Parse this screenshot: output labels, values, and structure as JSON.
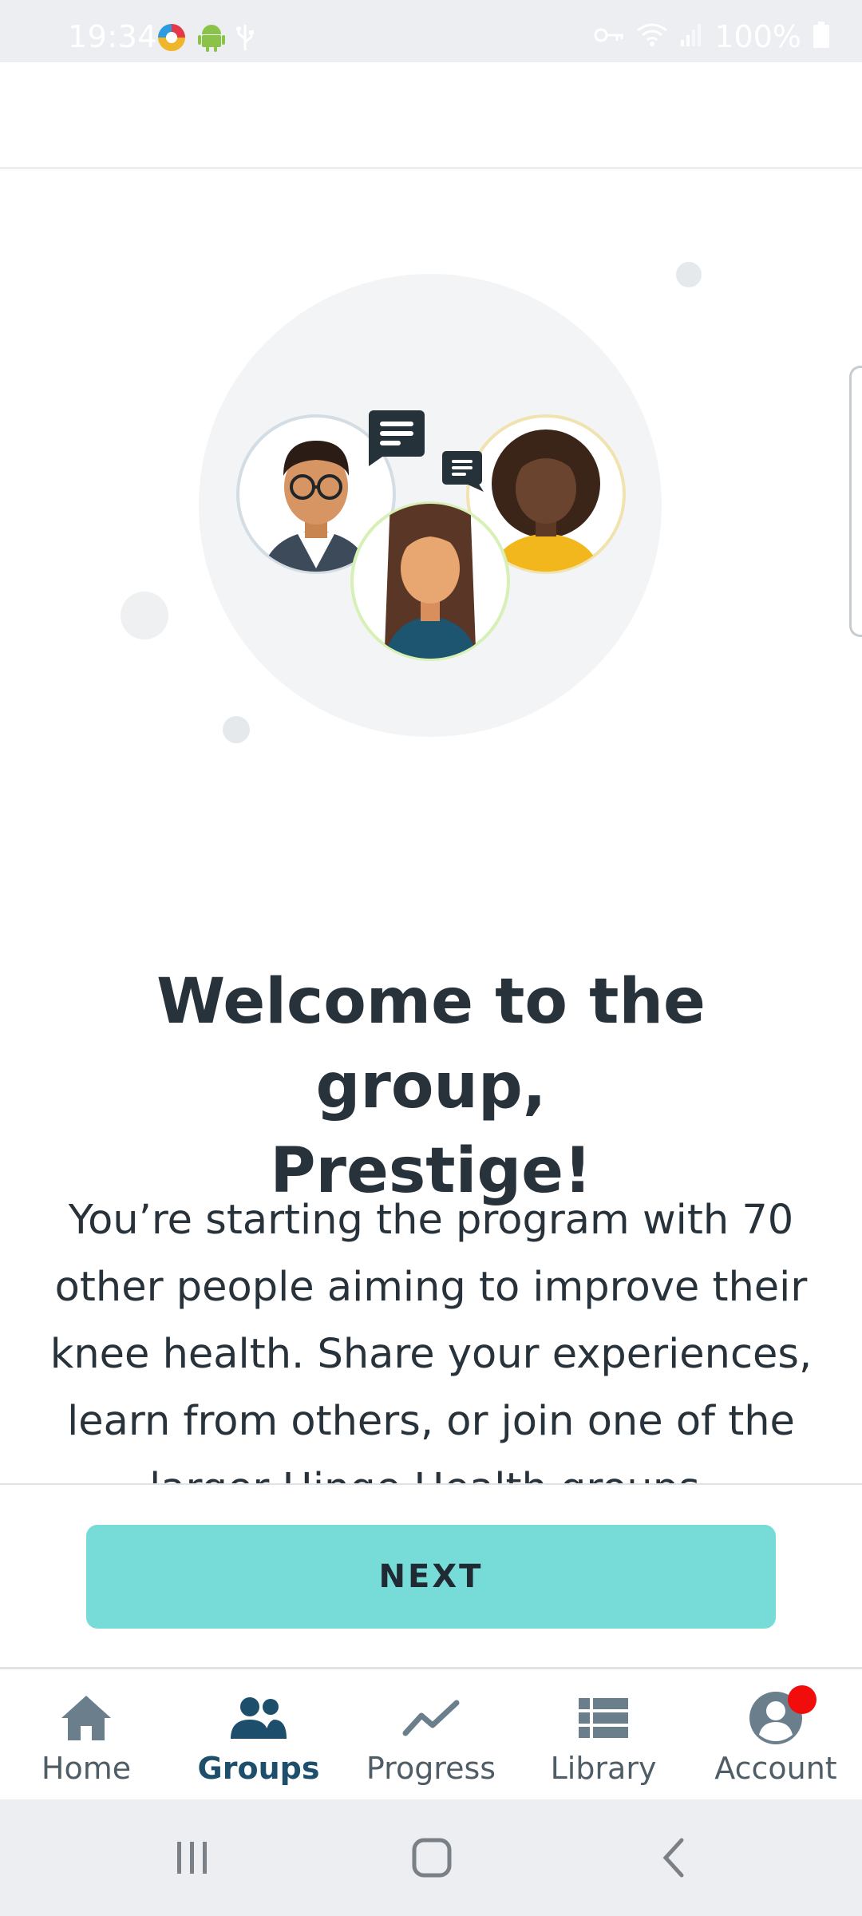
{
  "status_bar": {
    "time": "19:34",
    "battery_text": "100%",
    "left_icons": [
      "app-notification-icon",
      "android-icon",
      "usb-icon"
    ],
    "right_icons": [
      "vpn-key-icon",
      "wifi-icon",
      "signal-icon",
      "battery-icon"
    ]
  },
  "welcome": {
    "title_line1": "Welcome to the group,",
    "title_line2": "Prestige!",
    "body": "You’re starting the program with 70 other people aiming to improve their knee health. Share your experiences, learn from others, or join one of the larger Hinge Health groups."
  },
  "next_button": {
    "label": "NEXT"
  },
  "bottom_nav": {
    "items": [
      {
        "label": "Home",
        "icon": "home-icon"
      },
      {
        "label": "Groups",
        "icon": "groups-icon",
        "active": true
      },
      {
        "label": "Progress",
        "icon": "progress-icon"
      },
      {
        "label": "Library",
        "icon": "library-icon"
      },
      {
        "label": "Account",
        "icon": "account-icon",
        "badge": true
      }
    ]
  },
  "colors": {
    "accent_button": "#77dbd8",
    "active_nav": "#1d4e6b",
    "text_dark": "#28323a",
    "badge_red": "#f20d0d"
  }
}
